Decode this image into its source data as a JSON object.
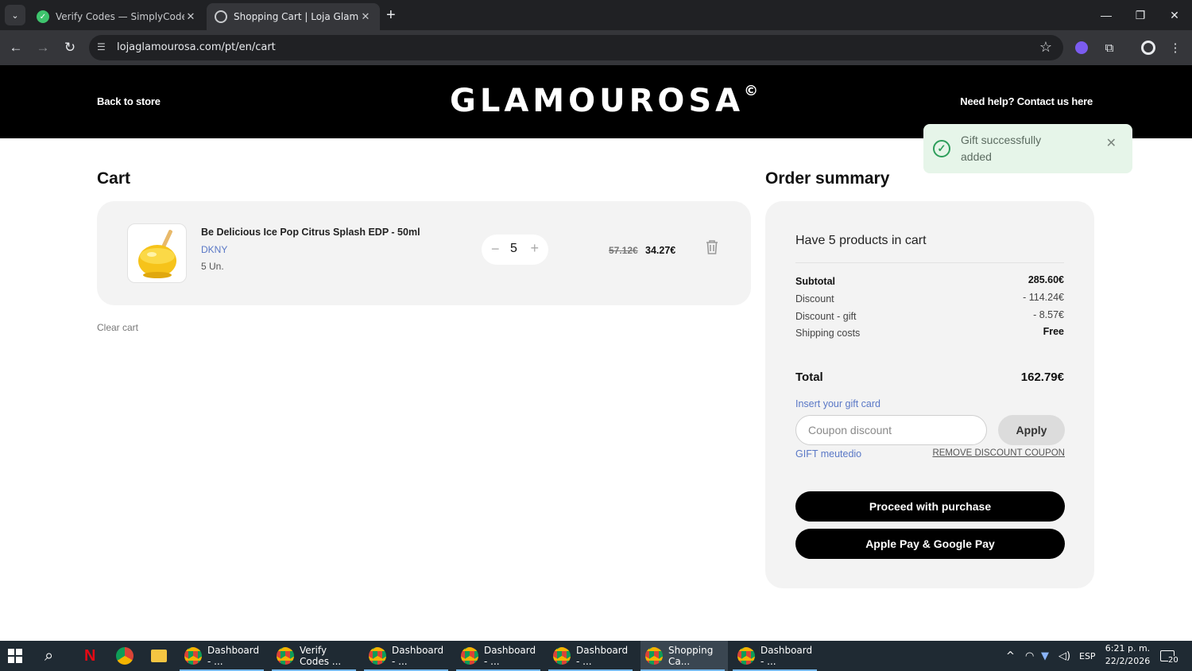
{
  "browser": {
    "tabs": [
      {
        "title": "Verify Codes — SimplyCodes",
        "active": false
      },
      {
        "title": "Shopping Cart | Loja Glamourosa",
        "active": true
      }
    ],
    "url": "lojaglamourosa.com/pt/en/cart"
  },
  "header": {
    "back_link": "Back to store",
    "logo": "GLAMOUROSA",
    "logo_mark": "©",
    "help_link": "Need help? Contact us here"
  },
  "toast": {
    "message": "Gift successfully added",
    "close_icon": "close-icon",
    "status_color": "#2e9e5b"
  },
  "cart": {
    "title": "Cart",
    "item": {
      "name": "Be Delicious Ice Pop Citrus Splash EDP - 50ml",
      "brand": "DKNY",
      "units": "5 Un.",
      "quantity": "5",
      "price_old": "57.12€",
      "price_new": "34.27€"
    },
    "clear_label": "Clear cart"
  },
  "summary": {
    "title": "Order summary",
    "products_text": "Have 5 products in cart",
    "rows": [
      {
        "label": "Subtotal",
        "value": "285.60€"
      },
      {
        "label": "Discount",
        "value": "- 114.24€"
      },
      {
        "label": "Discount - gift",
        "value": "- 8.57€"
      },
      {
        "label": "Shipping costs",
        "value": "Free"
      }
    ],
    "total_label": "Total",
    "total_value": "162.79€",
    "gift_card_label": "Insert your gift card",
    "coupon_placeholder": "Coupon discount",
    "apply_label": "Apply",
    "applied_code": "GIFT meutedio",
    "remove_coupon_label": "REMOVE DISCOUNT COUPON",
    "proceed_label": "Proceed with purchase",
    "pay_label": "Apple Pay & Google Pay",
    "accent_color": "#5a78c6"
  },
  "taskbar": {
    "apps": [
      {
        "label": "Dashboard - ..."
      },
      {
        "label": "Verify Codes ..."
      },
      {
        "label": "Dashboard - ..."
      },
      {
        "label": "Dashboard - ..."
      },
      {
        "label": "Dashboard - ..."
      },
      {
        "label": "Shopping Ca..."
      },
      {
        "label": "Dashboard - ..."
      }
    ],
    "language": "ESP",
    "time": "6:21 p. m.",
    "date": "22/2/2026",
    "notifications": "20"
  }
}
